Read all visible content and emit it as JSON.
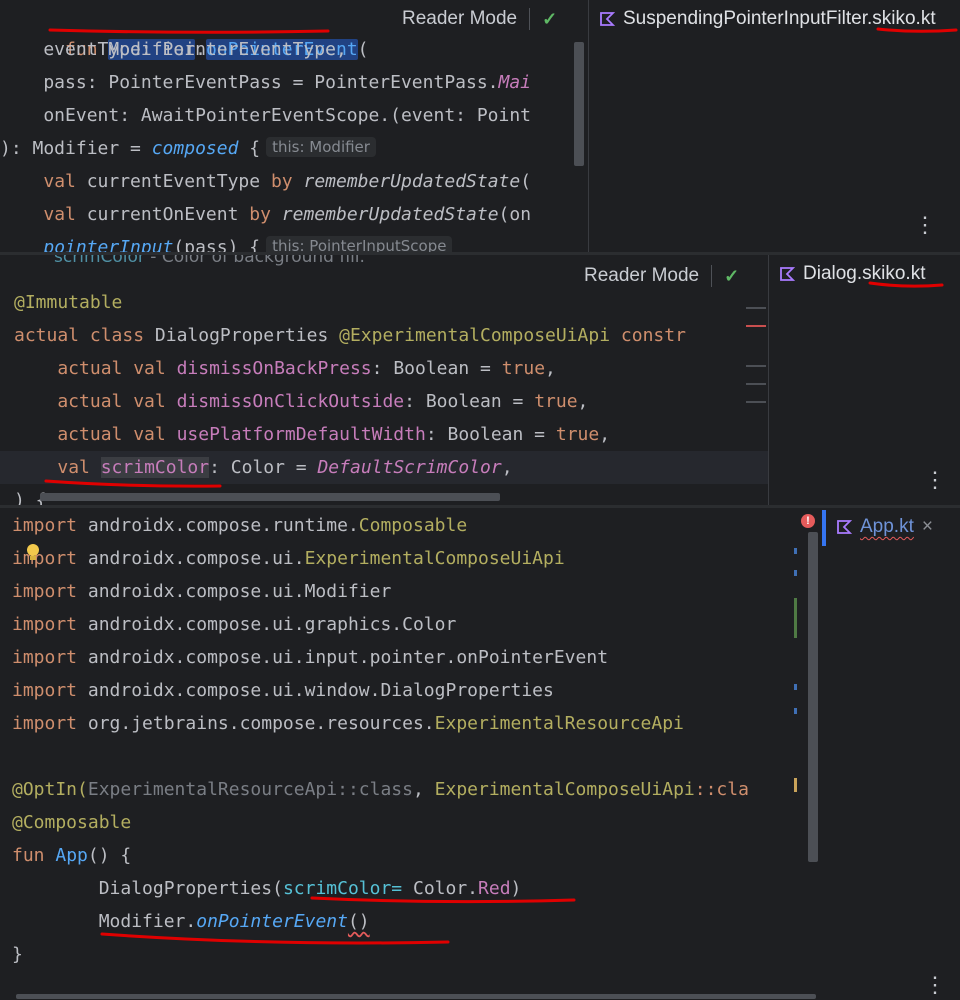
{
  "pane1": {
    "reader_mode": "Reader Mode",
    "tab_name": "SuspendingPointerInputFilter.skiko.kt",
    "lines": {
      "l1_fun": "fun ",
      "l1_modifier": "Modifier",
      "l1_dot": ".",
      "l1_name": "onPointerEvent",
      "l1_paren": "(",
      "l2": "    eventType: PointerEventType,",
      "l3_a": "    pass: PointerEventPass = PointerEventPass.",
      "l3_b": "Mai",
      "l4": "    onEvent: AwaitPointerEventScope.(event: Point",
      "l5_a": "): Modifier = ",
      "l5_b": "composed",
      "l5_c": " {",
      "l5_hint": "this: Modifier",
      "l6_a": "    ",
      "l6_val": "val",
      "l6_b": " currentEventType ",
      "l6_by": "by",
      "l6_c": " ",
      "l6_fn": "rememberUpdatedState",
      "l6_d": "(",
      "l7_a": "    ",
      "l7_val": "val",
      "l7_b": " currentOnEvent ",
      "l7_by": "by",
      "l7_c": " ",
      "l7_fn": "rememberUpdatedState",
      "l7_d": "(on",
      "l8_a": "    ",
      "l8_fn": "pointerInput",
      "l8_b": "(pass) {",
      "l8_hint": "this: PointerInputScope"
    }
  },
  "pane2": {
    "reader_mode": "Reader Mode",
    "tab_name": "Dialog.skiko.kt",
    "lines": {
      "l0_a": "          scrimColor",
      "l0_b": " - Color of background fill.",
      "l1": "@Immutable",
      "l2_a": "actual class ",
      "l2_b": "DialogProperties ",
      "l2_c": "@ExperimentalComposeUiApi ",
      "l2_d": "constr",
      "l3_a": "    actual val ",
      "l3_b": "dismissOnBackPress",
      "l3_c": ": Boolean = ",
      "l3_d": "true",
      "l3_e": ",",
      "l4_a": "    actual val ",
      "l4_b": "dismissOnClickOutside",
      "l4_c": ": Boolean = ",
      "l4_d": "true",
      "l4_e": ",",
      "l5_a": "    actual val ",
      "l5_b": "usePlatformDefaultWidth",
      "l5_c": ": Boolean = ",
      "l5_d": "true",
      "l5_e": ",",
      "l6_a": "    ",
      "l6_val": "val",
      "l6_b": " ",
      "l6_name": "scrimColor",
      "l6_c": ": Color = ",
      "l6_d": "DefaultScrimColor",
      "l6_e": ",",
      "l7": ") {"
    }
  },
  "pane3": {
    "tab_name": "App.kt",
    "tab_close": "×",
    "lines": {
      "i1_a": "import ",
      "i1_b": "androidx.compose.runtime.",
      "i1_c": "Composable",
      "i2_a": "import ",
      "i2_b": "androidx.compose.ui.",
      "i2_c": "ExperimentalComposeUiApi",
      "i3_a": "import ",
      "i3_b": "androidx.compose.ui.Modifier",
      "i4_a": "import ",
      "i4_b": "androidx.compose.ui.graphics.Color",
      "i5_a": "import ",
      "i5_b": "androidx.compose.ui.input.pointer.onPointerEvent",
      "i6_a": "import ",
      "i6_b": "androidx.compose.ui.window.DialogProperties",
      "i7_a": "import ",
      "i7_b": "org.jetbrains.compose.resources.",
      "i7_c": "ExperimentalResourceApi",
      "o_a": "@OptIn(",
      "o_b": "ExperimentalResourceApi::class",
      "o_c": ", ",
      "o_d": "ExperimentalComposeUiApi",
      "o_e": "::cla",
      "c1": "@Composable",
      "f_a": "fun ",
      "f_b": "App",
      "f_c": "() {",
      "d_a": "        DialogProperties(",
      "d_b": "scrimColor=",
      "d_c": " Color.",
      "d_d": "Red",
      "d_e": ")",
      "m_a": "        Modifier.",
      "m_b": "onPointerEvent",
      "m_c": "()",
      "close": "}"
    }
  },
  "colors": {
    "background": "#1e1f22",
    "keyword": "#cf8e6d",
    "function": "#56a8f5",
    "property": "#c77dbb",
    "annotation": "#b3ae60",
    "underline": "#e00000"
  }
}
